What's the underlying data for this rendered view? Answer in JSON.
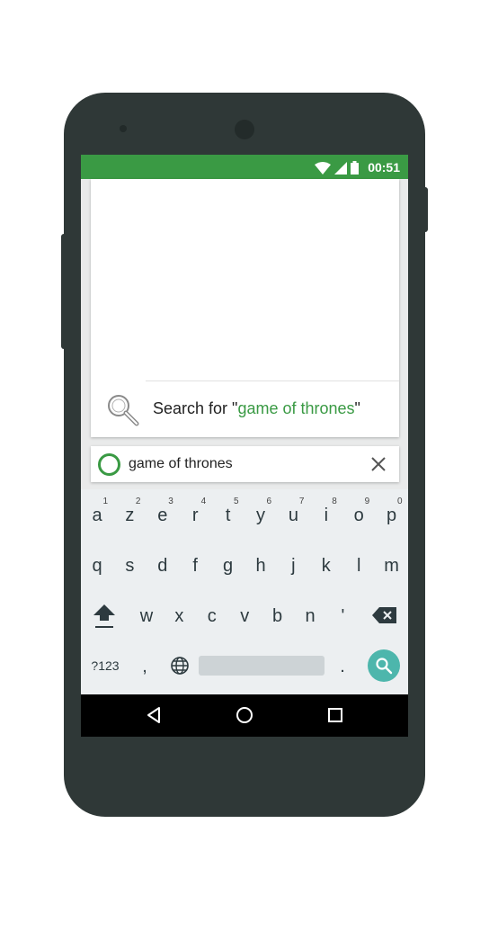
{
  "status_bar": {
    "time": "00:51",
    "icons": [
      "wifi-icon",
      "signal-icon",
      "battery-icon"
    ],
    "color": "#3a9a44"
  },
  "suggestion": {
    "prefix": "Search for \"",
    "query": "game of thrones",
    "suffix": "\""
  },
  "search": {
    "value": "game of thrones"
  },
  "keyboard": {
    "row1": [
      {
        "key": "a",
        "sup": "1"
      },
      {
        "key": "z",
        "sup": "2"
      },
      {
        "key": "e",
        "sup": "3"
      },
      {
        "key": "r",
        "sup": "4"
      },
      {
        "key": "t",
        "sup": "5"
      },
      {
        "key": "y",
        "sup": "6"
      },
      {
        "key": "u",
        "sup": "7"
      },
      {
        "key": "i",
        "sup": "8"
      },
      {
        "key": "o",
        "sup": "9"
      },
      {
        "key": "p",
        "sup": "0"
      }
    ],
    "row2": [
      "q",
      "s",
      "d",
      "f",
      "g",
      "h",
      "j",
      "k",
      "l",
      "m"
    ],
    "row3": [
      "w",
      "x",
      "c",
      "v",
      "b",
      "n",
      "'"
    ],
    "row4": {
      "symbols": "?123",
      "comma": ",",
      "period": "."
    }
  },
  "colors": {
    "accent": "#3a9a44",
    "search_key": "#4db6ac",
    "phone_body": "#2f3837"
  }
}
